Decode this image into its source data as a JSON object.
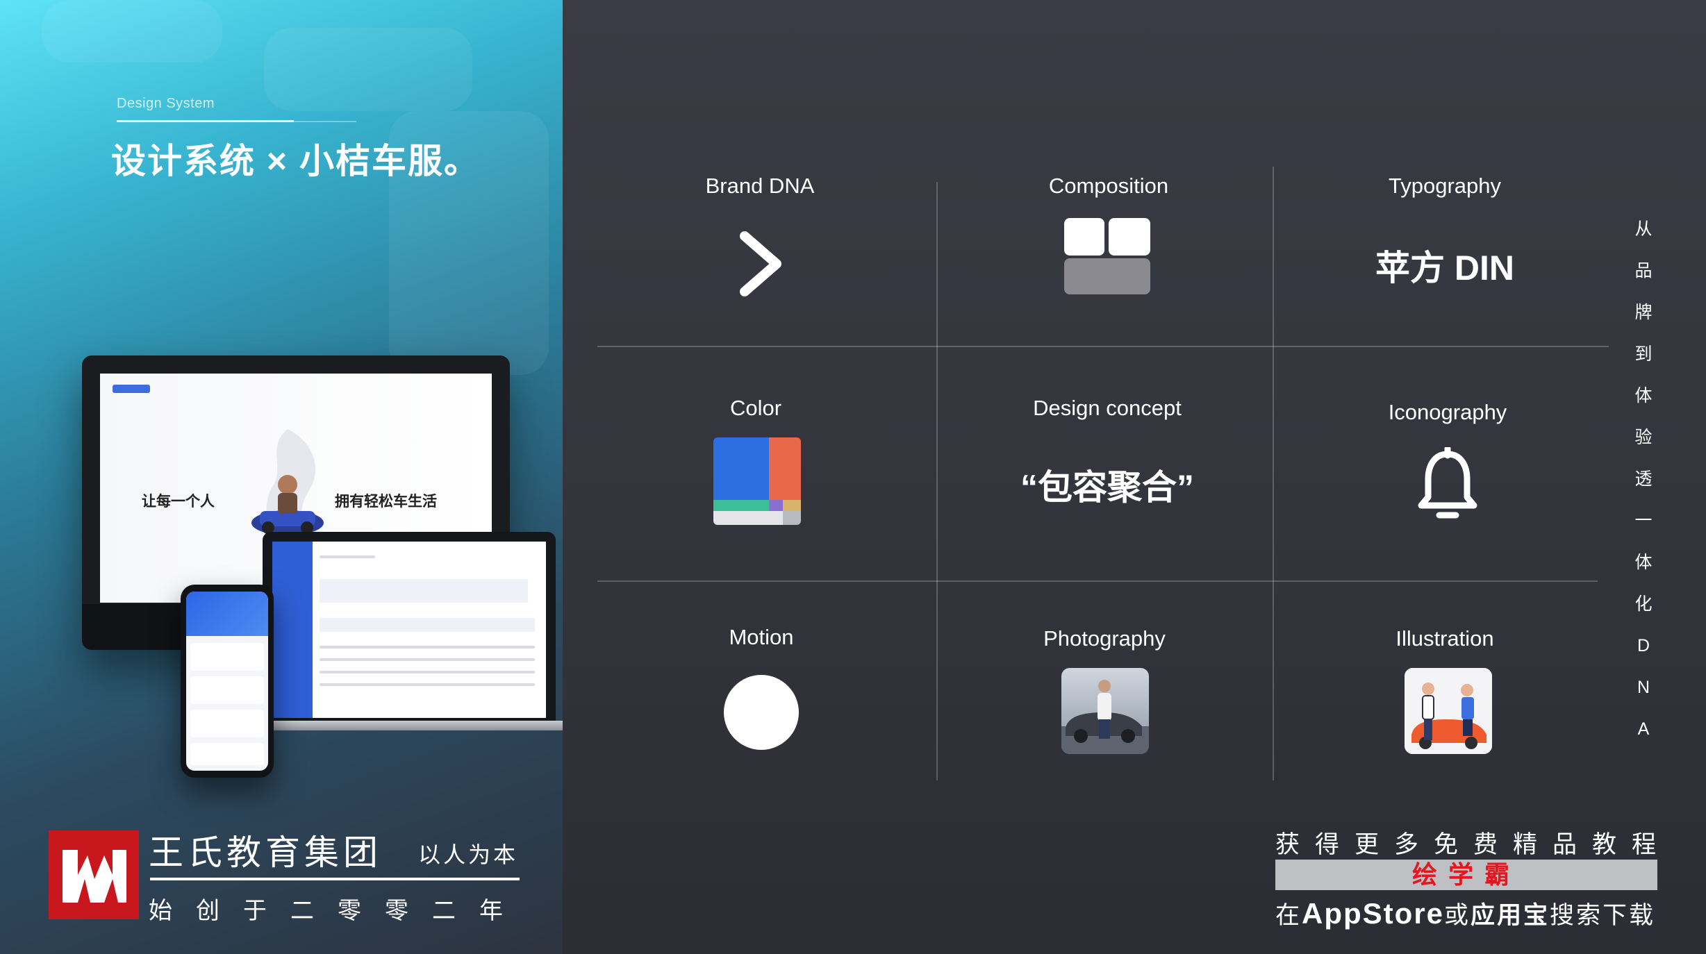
{
  "header": {
    "eyebrow": "Design System",
    "title": "设计系统 × 小桔车服。"
  },
  "showcase": {
    "desktop_left_text": "让每一个人",
    "desktop_right_text": "拥有轻松车生活"
  },
  "grid": {
    "brand_dna": {
      "label": "Brand DNA",
      "icon": "chevron-right-icon"
    },
    "composition": {
      "label": "Composition",
      "icon": "layout-grid-icon"
    },
    "typography": {
      "label": "Typography",
      "sample": "苹方 DIN"
    },
    "color": {
      "label": "Color",
      "swatches": [
        "#2d6ee0",
        "#e8684a",
        "#3dbd9a",
        "#8a6fd1",
        "#d9b36b",
        "#e6e6ea"
      ]
    },
    "design_concept": {
      "label": "Design concept",
      "sample": "“包容聚合”"
    },
    "iconography": {
      "label": "Iconography",
      "icon": "bell-icon"
    },
    "motion": {
      "label": "Motion",
      "icon": "circle-icon"
    },
    "photography": {
      "label": "Photography"
    },
    "illustration": {
      "label": "Illustration"
    }
  },
  "vertical_text": [
    "从",
    "品",
    "牌",
    "到",
    "体",
    "验",
    "透",
    "一",
    "体",
    "化",
    "D",
    "N",
    "A"
  ],
  "branding": {
    "name": "王氏教育集团",
    "slogan": "以人为本",
    "founded": "始创于二零零二年",
    "logo_color": "#c8171d"
  },
  "promo": {
    "line1": "获得更多免费精品教程",
    "highlight": "绘学霸",
    "line3_prefix": "在",
    "line3_store": "AppStore",
    "line3_or": "或",
    "line3_app": "应用宝",
    "line3_suffix": "搜索下载"
  }
}
